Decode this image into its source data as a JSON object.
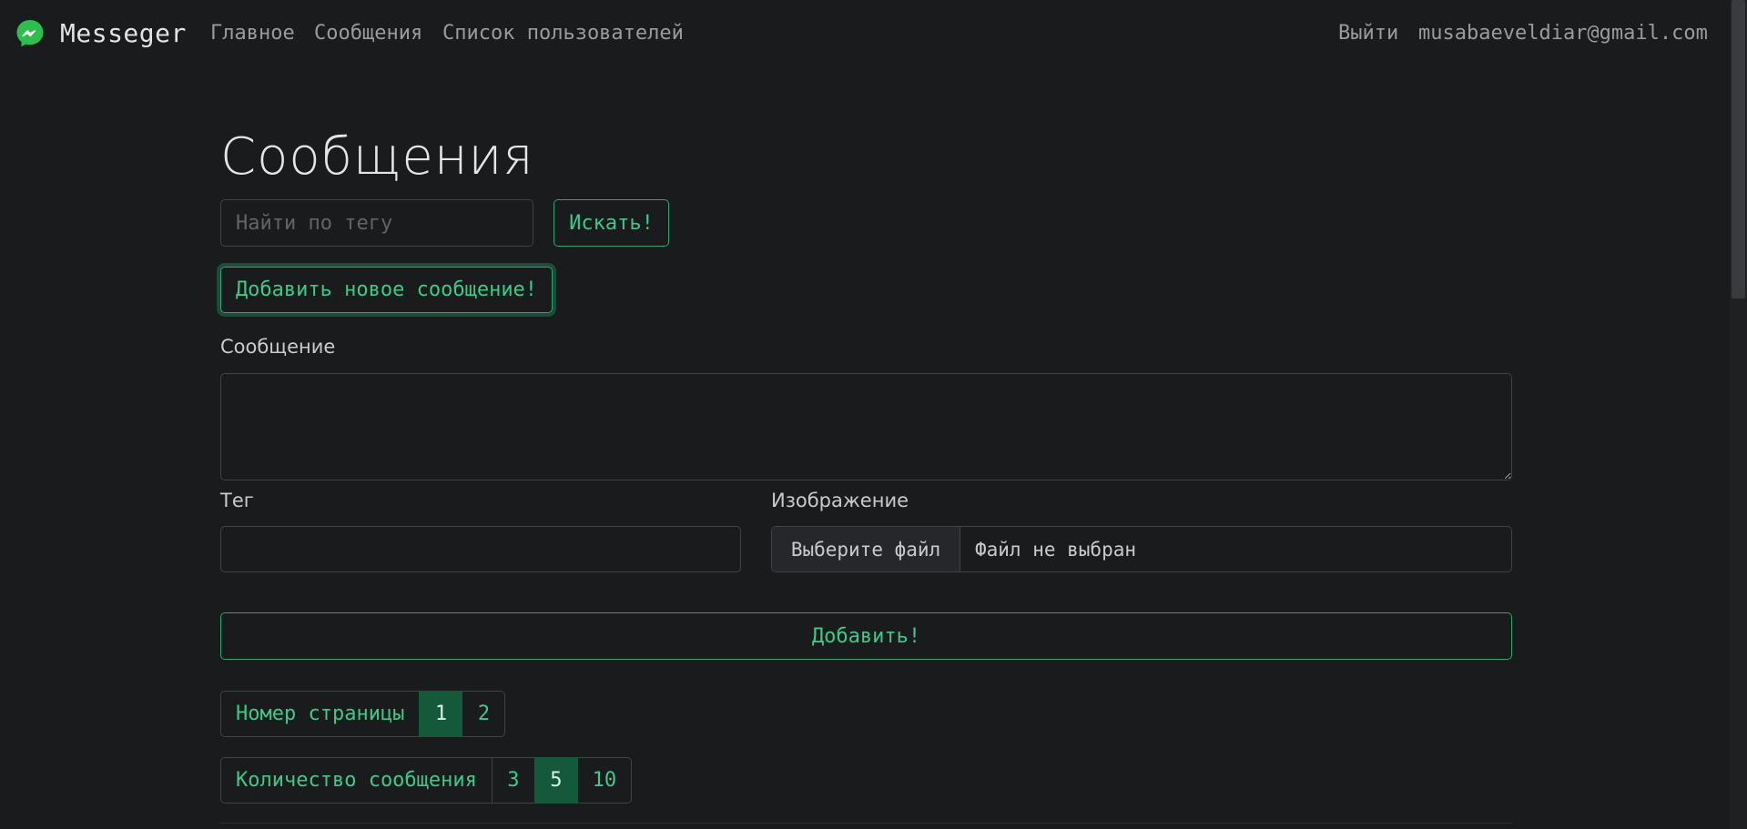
{
  "navbar": {
    "brand": "Messeger",
    "links": [
      "Главное",
      "Сообщения",
      "Список пользователей"
    ],
    "logout": "Выйти",
    "user_email": "musabaeveldiar@gmail.com"
  },
  "page": {
    "title": "Сообщения"
  },
  "search": {
    "placeholder": "Найти по тегу",
    "value": "",
    "button": "Искать!"
  },
  "add_toggle": "Добавить новое сообщение!",
  "form": {
    "message_label": "Сообщение",
    "message_value": "",
    "tag_label": "Тег",
    "tag_value": "",
    "image_label": "Изображение",
    "file_button": "Выберите файл",
    "file_status": "Файл не выбран",
    "submit": "Добавить!"
  },
  "pagination": {
    "label": "Номер страницы",
    "pages": [
      "1",
      "2"
    ],
    "current": "1"
  },
  "page_size": {
    "label": "Количество сообщения",
    "options": [
      "3",
      "5",
      "10"
    ],
    "current": "5"
  },
  "colors": {
    "background": "#1a1b1d",
    "accent": "#3fc888",
    "active_bg": "#14593a",
    "logo": "#2ebd4f"
  }
}
